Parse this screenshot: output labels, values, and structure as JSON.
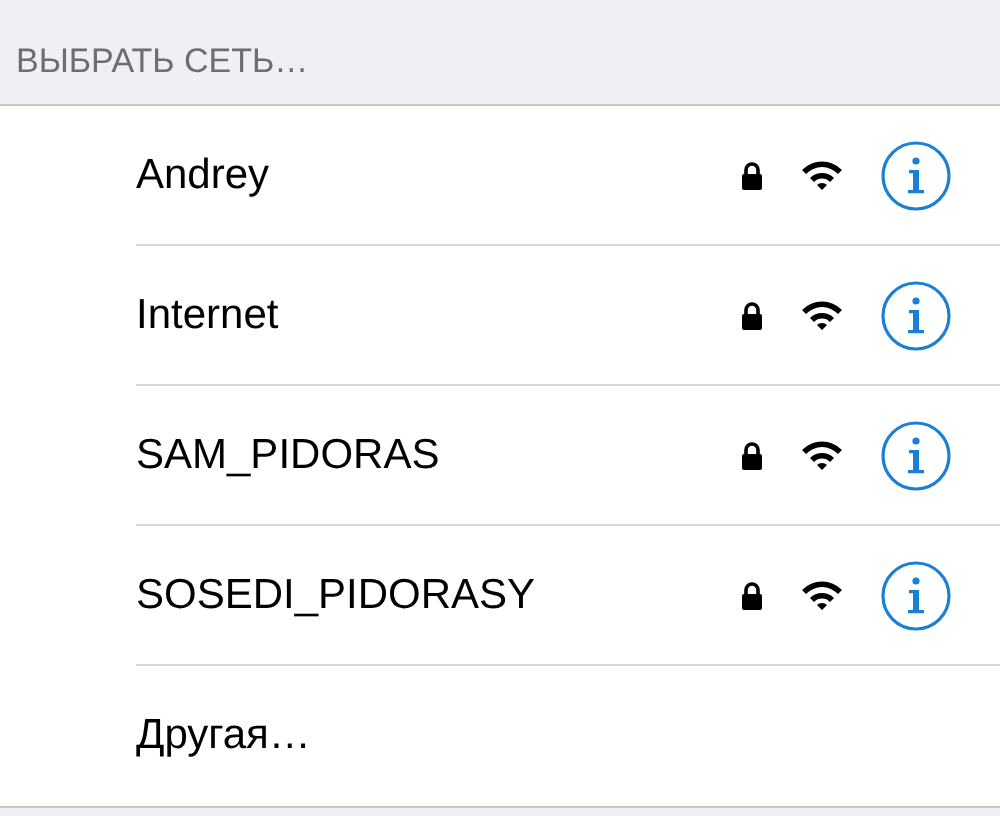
{
  "section_header": "ВЫБРАТЬ СЕТЬ…",
  "networks": [
    {
      "kind": "network",
      "name": "Andrey",
      "locked": true
    },
    {
      "kind": "network",
      "name": "Internet",
      "locked": true
    },
    {
      "kind": "network",
      "name": "SAM_PIDORAS",
      "locked": true
    },
    {
      "kind": "network",
      "name": "SOSEDI_PIDORASY",
      "locked": true
    },
    {
      "kind": "other",
      "name": "Другая…"
    }
  ]
}
